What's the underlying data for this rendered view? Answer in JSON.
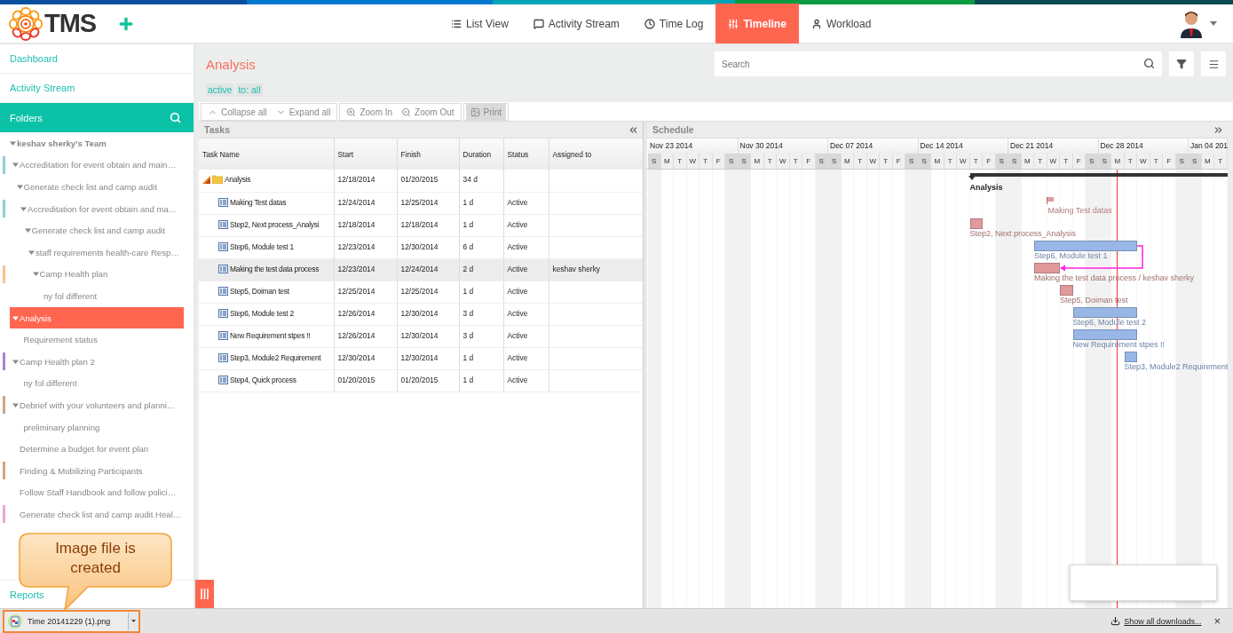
{
  "header": {
    "logo": "TMS",
    "nav": [
      {
        "label": "List View",
        "kind": "list",
        "selected": false
      },
      {
        "label": "Activity Stream",
        "kind": "chat",
        "selected": false
      },
      {
        "label": "Time Log",
        "kind": "clock",
        "selected": false
      },
      {
        "label": "Timeline",
        "kind": "timeline",
        "selected": true
      },
      {
        "label": "Workload",
        "kind": "user",
        "selected": false
      }
    ]
  },
  "sidebar": {
    "links": [
      "Dashboard",
      "Activity Stream"
    ],
    "folders_title": "Folders",
    "tree": [
      {
        "label": "keshav sherky's Team",
        "expanded": true,
        "selected": false,
        "children": [
          {
            "label": "Accreditation for event obtain and main…",
            "color": "#8ccfd8",
            "expanded": true,
            "selected": false,
            "children": [
              {
                "label": "Generate check list and camp audit",
                "expanded": true,
                "selected": false,
                "children": [
                  {
                    "label": "Accreditation for event obtain and ma…",
                    "color": "#8ccfd8",
                    "expanded": true,
                    "selected": false,
                    "children": [
                      {
                        "label": "Generate check list and camp audit",
                        "expanded": true,
                        "selected": false,
                        "children": [
                          {
                            "label": "staff requirements health-care Resp…",
                            "expanded": true,
                            "selected": false,
                            "children": [
                              {
                                "label": "Camp Health plan",
                                "color": "#fbc08e",
                                "expanded": true,
                                "selected": false,
                                "children": [
                                  {
                                    "label": "ny fol different",
                                    "selected": false
                                  }
                                ]
                              }
                            ]
                          }
                        ]
                      }
                    ]
                  }
                ]
              }
            ]
          },
          {
            "label": "Analysis",
            "expanded": true,
            "selected": true,
            "children": [
              {
                "label": "Requirement status",
                "selected": false
              }
            ]
          },
          {
            "label": "Camp Health plan 2",
            "color": "#a287d3",
            "expanded": true,
            "selected": false,
            "children": [
              {
                "label": "ny fol different",
                "selected": false
              }
            ]
          },
          {
            "label": "Debrief with your volunteers and planni…",
            "color": "#cfa886",
            "expanded": true,
            "selected": false,
            "children": [
              {
                "label": "preliminary planning",
                "selected": false
              }
            ]
          },
          {
            "label": "Determine a budget for event plan",
            "selected": false
          },
          {
            "label": "Finding & Mobilizing Participants",
            "color": "#cfa886",
            "selected": false
          },
          {
            "label": "Follow Staff Handbook and follow polici…",
            "selected": false
          },
          {
            "label": "Generate check list and camp audit Heal…",
            "color": "#eaa6da",
            "selected": false
          }
        ]
      }
    ],
    "footer_link": "Reports"
  },
  "main": {
    "title": "Analysis",
    "tags": [
      "active",
      "to: all"
    ],
    "search": {
      "placeholder": "Search"
    },
    "toolbar": [
      [
        {
          "label": "Collapse all",
          "kind": "collapse",
          "disabled": false
        },
        {
          "label": "Expand all",
          "kind": "expand",
          "disabled": false
        }
      ],
      [
        {
          "label": "Zoom In",
          "kind": "zoom-in",
          "disabled": false
        },
        {
          "label": "Zoom Out",
          "kind": "zoom-out",
          "disabled": false
        }
      ],
      [
        {
          "label": "Print",
          "kind": "print",
          "disabled": true
        }
      ]
    ]
  },
  "tasks": {
    "title": "Tasks",
    "columns": [
      "Task Name",
      "Start",
      "Finish",
      "Duration",
      "Status",
      "Assigned to"
    ],
    "rows": [
      {
        "kind": "folder",
        "name": "Analysis",
        "start": "12/18/2014",
        "finish": "01/20/2015",
        "duration": "34 d",
        "selected": false
      },
      {
        "kind": "task",
        "name": "Making Test datas",
        "start": "12/24/2014",
        "finish": "12/25/2014",
        "duration": "1 d",
        "status": "Active",
        "selected": false
      },
      {
        "kind": "task",
        "name": "Step2, Next process_Analysi",
        "start": "12/18/2014",
        "finish": "12/18/2014",
        "duration": "1 d",
        "status": "Active",
        "selected": false
      },
      {
        "kind": "task",
        "name": "Step6, Module test 1",
        "start": "12/23/2014",
        "finish": "12/30/2014",
        "duration": "6 d",
        "status": "Active",
        "selected": false
      },
      {
        "kind": "task",
        "name": "Making the test data process",
        "start": "12/23/2014",
        "finish": "12/24/2014",
        "duration": "2 d",
        "status": "Active",
        "assigned": "keshav sherky",
        "selected": true
      },
      {
        "kind": "task",
        "name": "Step5, Doiman test",
        "start": "12/25/2014",
        "finish": "12/25/2014",
        "duration": "1 d",
        "status": "Active",
        "selected": false
      },
      {
        "kind": "task",
        "name": "Step6, Module test 2",
        "start": "12/26/2014",
        "finish": "12/30/2014",
        "duration": "3 d",
        "status": "Active",
        "selected": false
      },
      {
        "kind": "task",
        "name": "New Requirement stpes !!",
        "start": "12/26/2014",
        "finish": "12/30/2014",
        "duration": "3 d",
        "status": "Active",
        "selected": false
      },
      {
        "kind": "task",
        "name": "Step3, Module2 Requirement",
        "start": "12/30/2014",
        "finish": "12/30/2014",
        "duration": "1 d",
        "status": "Active",
        "selected": false
      },
      {
        "kind": "task",
        "name": "Step4, Quick process",
        "start": "01/20/2015",
        "finish": "01/20/2015",
        "duration": "1 d",
        "status": "Active",
        "selected": false
      }
    ]
  },
  "schedule": {
    "title": "Schedule",
    "weeks": [
      {
        "label": "Nov 23 2014",
        "days": [
          {
            "d": "S",
            "weekend": true
          },
          {
            "d": "M",
            "weekend": false
          },
          {
            "d": "T",
            "weekend": false
          },
          {
            "d": "W",
            "weekend": false
          },
          {
            "d": "T",
            "weekend": false
          },
          {
            "d": "F",
            "weekend": false
          },
          {
            "d": "S",
            "weekend": true
          }
        ]
      },
      {
        "label": "Nov 30 2014",
        "days": [
          {
            "d": "S",
            "weekend": true
          },
          {
            "d": "M",
            "weekend": false
          },
          {
            "d": "T",
            "weekend": false
          },
          {
            "d": "W",
            "weekend": false
          },
          {
            "d": "T",
            "weekend": false
          },
          {
            "d": "F",
            "weekend": false
          },
          {
            "d": "S",
            "weekend": true
          }
        ]
      },
      {
        "label": "Dec 07 2014",
        "days": [
          {
            "d": "S",
            "weekend": true
          },
          {
            "d": "M",
            "weekend": false
          },
          {
            "d": "T",
            "weekend": false
          },
          {
            "d": "W",
            "weekend": false
          },
          {
            "d": "T",
            "weekend": false
          },
          {
            "d": "F",
            "weekend": false
          },
          {
            "d": "S",
            "weekend": true
          }
        ]
      },
      {
        "label": "Dec 14 2014",
        "days": [
          {
            "d": "S",
            "weekend": true
          },
          {
            "d": "M",
            "weekend": false
          },
          {
            "d": "T",
            "weekend": false
          },
          {
            "d": "W",
            "weekend": false
          },
          {
            "d": "T",
            "weekend": false
          },
          {
            "d": "F",
            "weekend": false
          },
          {
            "d": "S",
            "weekend": true
          }
        ]
      },
      {
        "label": "Dec 21 2014",
        "days": [
          {
            "d": "S",
            "weekend": true
          },
          {
            "d": "M",
            "weekend": false
          },
          {
            "d": "T",
            "weekend": false
          },
          {
            "d": "W",
            "weekend": false
          },
          {
            "d": "T",
            "weekend": false
          },
          {
            "d": "F",
            "weekend": false
          },
          {
            "d": "S",
            "weekend": true
          }
        ]
      },
      {
        "label": "Dec 28 2014",
        "days": [
          {
            "d": "S",
            "weekend": true
          },
          {
            "d": "M",
            "weekend": false
          },
          {
            "d": "T",
            "weekend": false
          },
          {
            "d": "W",
            "weekend": false
          },
          {
            "d": "T",
            "weekend": false
          },
          {
            "d": "F",
            "weekend": false
          },
          {
            "d": "S",
            "weekend": true
          }
        ]
      },
      {
        "label": "Jan 04 201",
        "days": [
          {
            "d": "S",
            "weekend": true
          },
          {
            "d": "M",
            "weekend": false
          },
          {
            "d": "T",
            "weekend": false
          }
        ]
      }
    ],
    "items": [
      {
        "label": "Analysis",
        "kind": "summary"
      },
      {
        "label": "Making Test datas",
        "kind": "milestone",
        "color": "#e09a9c"
      },
      {
        "label": "Step2, Next process_Analysis",
        "kind": "bar",
        "color": "#e09a9c"
      },
      {
        "label": "Step6, Module test 1",
        "kind": "bar",
        "color": "#98b6e6"
      },
      {
        "label": "Making the test data process / keshav sherky",
        "kind": "bar",
        "color": "#e09a9c",
        "arrow_from_previous": true
      },
      {
        "label": "Step5, Doiman test",
        "kind": "bar",
        "color": "#e09a9c"
      },
      {
        "label": "Step6, Module test 2",
        "kind": "bar",
        "color": "#98b6e6"
      },
      {
        "label": "New Requirement stpes !!",
        "kind": "bar",
        "color": "#98b6e6"
      },
      {
        "label": "Step3, Module2 Requirement",
        "kind": "bar",
        "color": "#98b6e6"
      }
    ]
  },
  "callout": "Image file is created",
  "downloads": {
    "file": "Time 20141229 (1).png",
    "show_all": "Show all downloads...",
    "close": "×"
  }
}
